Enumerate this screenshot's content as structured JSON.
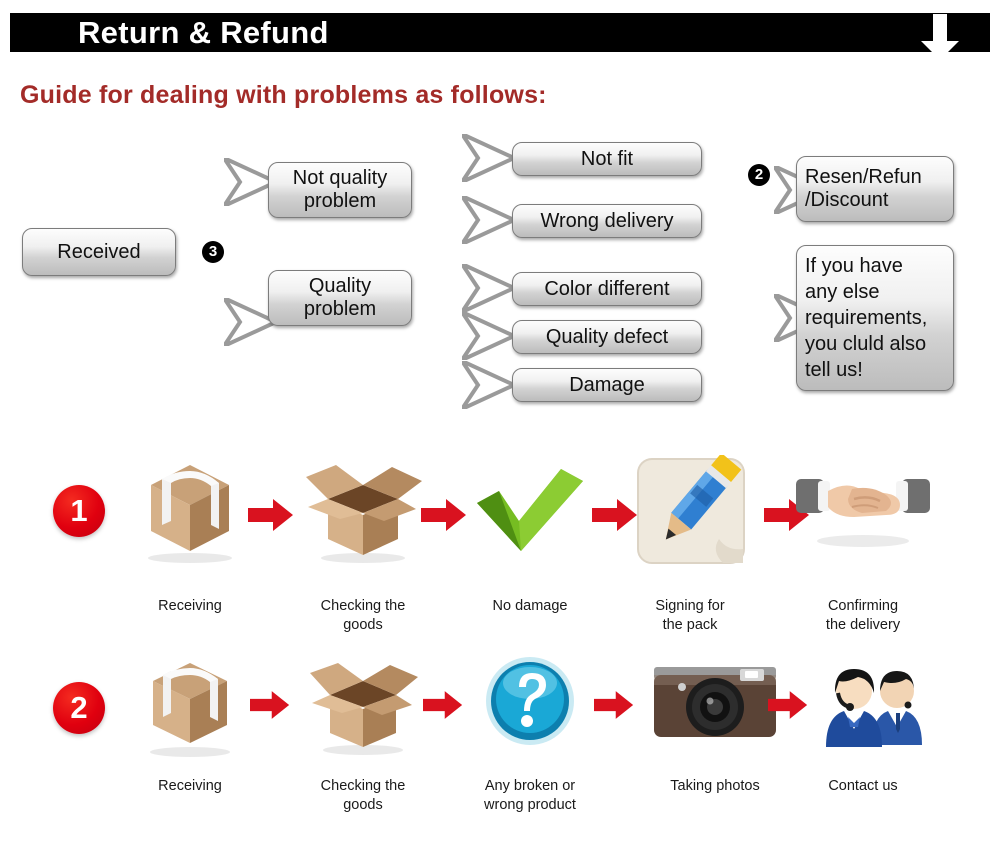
{
  "header": {
    "title": "Return & Refund",
    "arrow_icon": "arrow-down-icon"
  },
  "guide": {
    "heading": "Guide for dealing with problems as follows:"
  },
  "flowchart": {
    "start": {
      "label": "Received"
    },
    "badges": {
      "three": "3",
      "two": "2"
    },
    "branches": [
      {
        "label": "Not quality\nproblem"
      },
      {
        "label": "Quality\nproblem"
      }
    ],
    "problem_types": [
      {
        "label": "Not fit"
      },
      {
        "label": "Wrong delivery"
      },
      {
        "label": "Color different"
      },
      {
        "label": "Quality defect"
      },
      {
        "label": "Damage"
      }
    ],
    "outcomes": [
      {
        "label": "Resen/Refun\n/Discount"
      },
      {
        "label": "If you have\nany else\nrequirements,\nyou cluld also\ntell us!"
      }
    ]
  },
  "process_rows": [
    {
      "number": "1",
      "steps": [
        {
          "icon": "closed-box-icon",
          "caption": "Receiving"
        },
        {
          "icon": "open-box-icon",
          "caption": "Checking the\ngoods"
        },
        {
          "icon": "green-check-icon",
          "caption": "No damage"
        },
        {
          "icon": "pencil-sign-icon",
          "caption": "Signing for\nthe pack"
        },
        {
          "icon": "handshake-icon",
          "caption": "Confirming\nthe delivery"
        }
      ]
    },
    {
      "number": "2",
      "steps": [
        {
          "icon": "closed-box-icon",
          "caption": "Receiving"
        },
        {
          "icon": "open-box-icon",
          "caption": "Checking the\ngoods"
        },
        {
          "icon": "question-mark-icon",
          "caption": "Any broken or\nwrong product"
        },
        {
          "icon": "camera-icon",
          "caption": "Taking photos"
        },
        {
          "icon": "support-agents-icon",
          "caption": "Contact us"
        }
      ]
    }
  ],
  "arrow_icon_name": "red-arrow-right-icon",
  "colors": {
    "header_bg": "#000000",
    "header_text": "#ffffff",
    "heading_red": "#A32B28",
    "arrow_red": "#D9121F",
    "circle_red": "#E0000F",
    "box_border": "#7c7c7c"
  }
}
